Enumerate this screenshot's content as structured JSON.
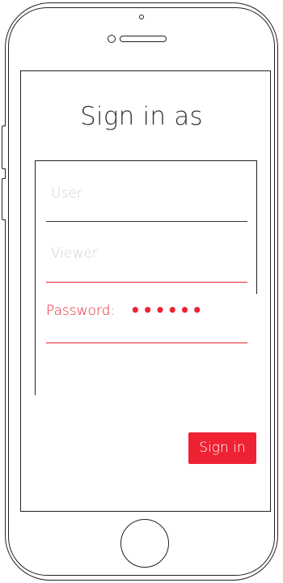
{
  "screen": {
    "title": "Sign in as"
  },
  "form": {
    "user_placeholder": "User",
    "viewer_placeholder": "Viewer",
    "password_label": "Password:",
    "password_masked": "••••••"
  },
  "actions": {
    "signin_label": "Sign in"
  },
  "colors": {
    "accent": "#ee2233",
    "placeholder": "#cfcfcf",
    "outline": "#222222"
  }
}
